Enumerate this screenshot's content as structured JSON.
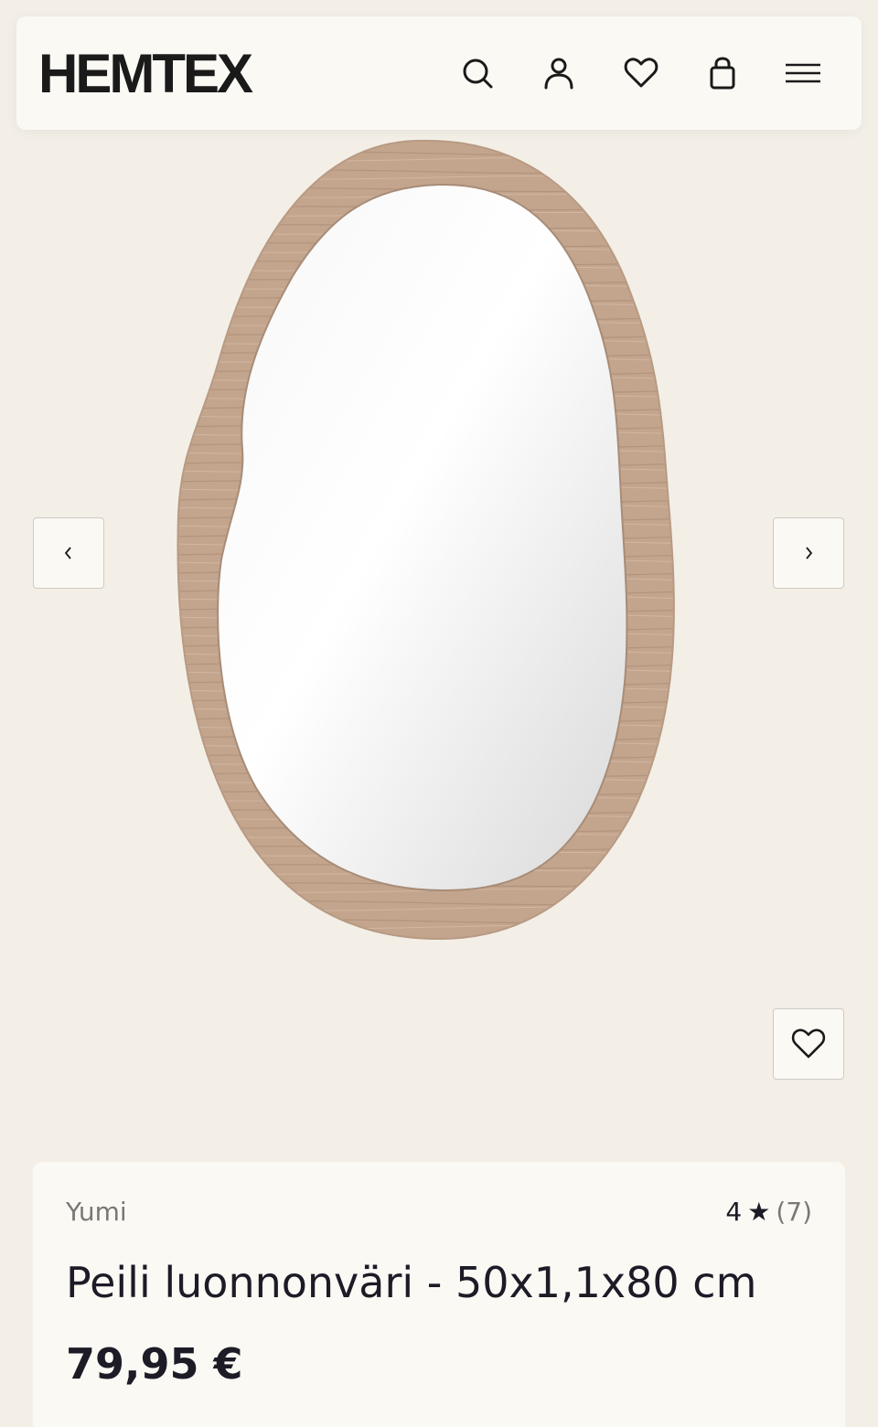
{
  "header": {
    "logo": "HEMTEX",
    "icons": [
      "search-icon",
      "account-icon",
      "wishlist-icon",
      "cart-icon",
      "menu-icon"
    ]
  },
  "gallery": {
    "prev_icon": "chevron-left-icon",
    "next_icon": "chevron-right-icon",
    "favorite_icon": "heart-icon"
  },
  "product": {
    "brand": "Yumi",
    "rating": "4",
    "rating_star": "★",
    "review_count": "(7)",
    "title": "Peili luonnonväri - 50x1,1x80 cm",
    "price": "79,95 €"
  },
  "colors": {
    "background": "#f3efe7",
    "surface": "#fbf9f4",
    "text": "#1d1b26",
    "muted": "#7a7876",
    "wood": "#c3a58e"
  }
}
